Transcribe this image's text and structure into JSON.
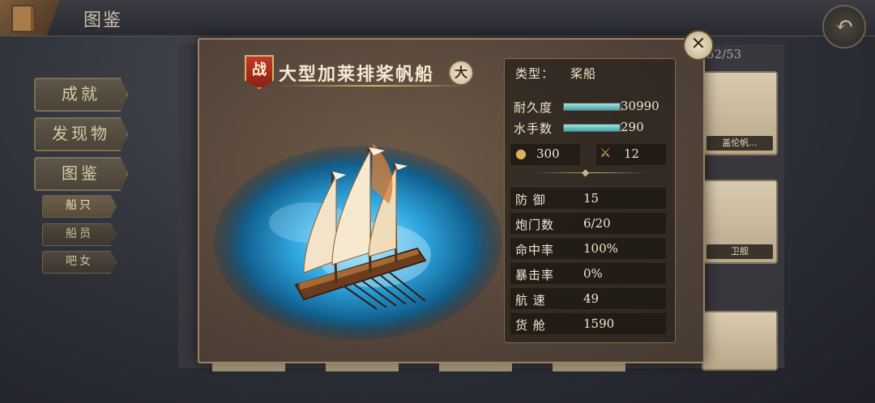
{
  "header": {
    "title": "图鉴"
  },
  "nav": {
    "achievements": "成就",
    "discoveries": "发现物",
    "codex": "图鉴",
    "sub": [
      "船只",
      "船员",
      "吧女"
    ]
  },
  "collection": {
    "counter": "52/53"
  },
  "bg_cards": [
    "盖伦帆...",
    "卫舰"
  ],
  "ship": {
    "battle_badge": "战",
    "name": "大型加莱排桨帆船",
    "size_badge": "大",
    "type_label": "类型：",
    "type_value": "桨船",
    "durability_label": "耐久度",
    "durability_value": "30990",
    "durability_fill": 0.98,
    "sailors_label": "水手数",
    "sailors_value": "290",
    "sailors_fill": 0.98,
    "cannon_value": "300",
    "melee_value": "12",
    "stats": [
      {
        "label": "防  御",
        "value": "15"
      },
      {
        "label": "炮门数",
        "value": "6/20"
      },
      {
        "label": "命中率",
        "value": "100%"
      },
      {
        "label": "暴击率",
        "value": "0%"
      },
      {
        "label": "航  速",
        "value": "49"
      },
      {
        "label": "货  舱",
        "value": "1590"
      }
    ]
  },
  "icons": {
    "back": "back-arrow-icon",
    "close": "close-icon",
    "cannon": "cannon-icon",
    "swords": "crossed-swords-icon"
  },
  "colors": {
    "accent": "#d9b25a",
    "bar": "#7fd0d0",
    "badge": "#c0392b"
  }
}
